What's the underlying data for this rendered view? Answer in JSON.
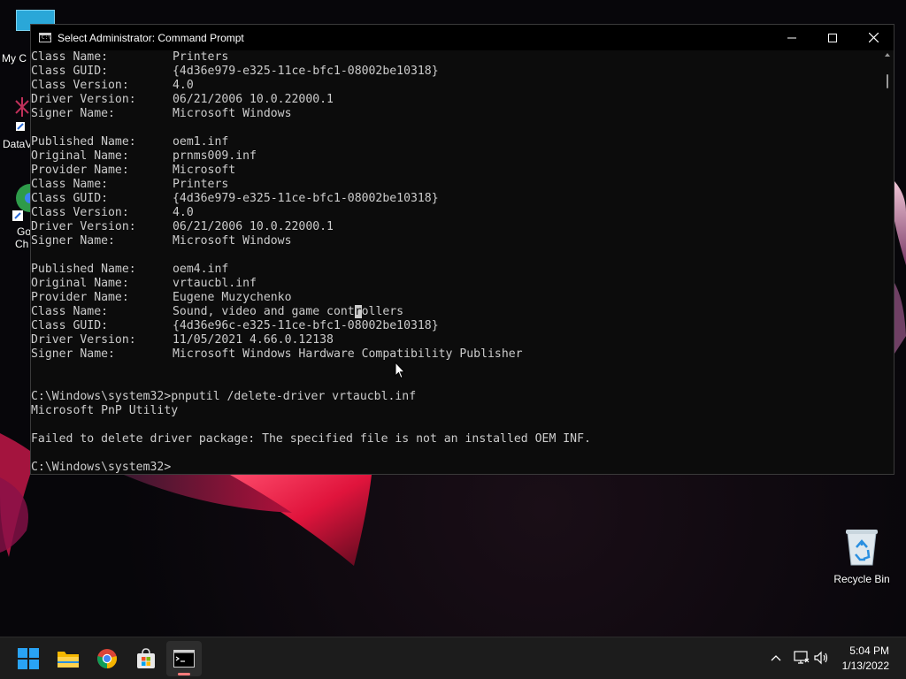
{
  "window": {
    "title": "Select Administrator: Command Prompt",
    "app_icon_text": "C:\\"
  },
  "console_lines": [
    {
      "label": "Class Name:",
      "value": "Printers"
    },
    {
      "label": "Class GUID:",
      "value": "{4d36e979-e325-11ce-bfc1-08002be10318}"
    },
    {
      "label": "Class Version:",
      "value": "4.0"
    },
    {
      "label": "Driver Version:",
      "value": "06/21/2006 10.0.22000.1"
    },
    {
      "label": "Signer Name:",
      "value": "Microsoft Windows"
    },
    {
      "label": "",
      "value": ""
    },
    {
      "label": "Published Name:",
      "value": "oem1.inf"
    },
    {
      "label": "Original Name:",
      "value": "prnms009.inf"
    },
    {
      "label": "Provider Name:",
      "value": "Microsoft"
    },
    {
      "label": "Class Name:",
      "value": "Printers"
    },
    {
      "label": "Class GUID:",
      "value": "{4d36e979-e325-11ce-bfc1-08002be10318}"
    },
    {
      "label": "Class Version:",
      "value": "4.0"
    },
    {
      "label": "Driver Version:",
      "value": "06/21/2006 10.0.22000.1"
    },
    {
      "label": "Signer Name:",
      "value": "Microsoft Windows"
    },
    {
      "label": "",
      "value": ""
    },
    {
      "label": "Published Name:",
      "value": "oem4.inf"
    },
    {
      "label": "Original Name:",
      "value": "vrtaucbl.inf"
    },
    {
      "label": "Provider Name:",
      "value": "Eugene Muzychenko"
    },
    {
      "label": "Class Name:",
      "value": "Sound, video and game controllers",
      "selected_char_index": 26
    },
    {
      "label": "Class GUID:",
      "value": "{4d36e96c-e325-11ce-bfc1-08002be10318}"
    },
    {
      "label": "Driver Version:",
      "value": "11/05/2021 4.66.0.12138"
    },
    {
      "label": "Signer Name:",
      "value": "Microsoft Windows Hardware Compatibility Publisher"
    },
    {
      "label": "",
      "value": ""
    },
    {
      "label": "",
      "value": ""
    },
    {
      "text": "C:\\Windows\\system32>pnputil /delete-driver vrtaucbl.inf"
    },
    {
      "text": "Microsoft PnP Utility"
    },
    {
      "text": ""
    },
    {
      "text": "Failed to delete driver package: The specified file is not an installed OEM INF."
    },
    {
      "text": ""
    },
    {
      "text": "C:\\Windows\\system32>"
    }
  ],
  "desktop": {
    "recycle_bin_label": "Recycle Bin",
    "left_labels": [
      "My C",
      "DataV",
      "Go",
      "Ch"
    ]
  },
  "taskbar": {
    "apps": [
      "start-icon",
      "file-explorer-icon",
      "chrome-icon",
      "microsoft-store-icon",
      "command-prompt-icon"
    ],
    "active_app": "command-prompt-icon",
    "time": "5:04 PM",
    "date": "1/13/2022"
  },
  "colors": {
    "console_bg": "#0c0c0c",
    "console_text": "#cccccc",
    "taskbar_bg": "#1c1c1c",
    "active_indicator": "#ff7b7b",
    "wallpaper_accent": "#e0143c"
  }
}
